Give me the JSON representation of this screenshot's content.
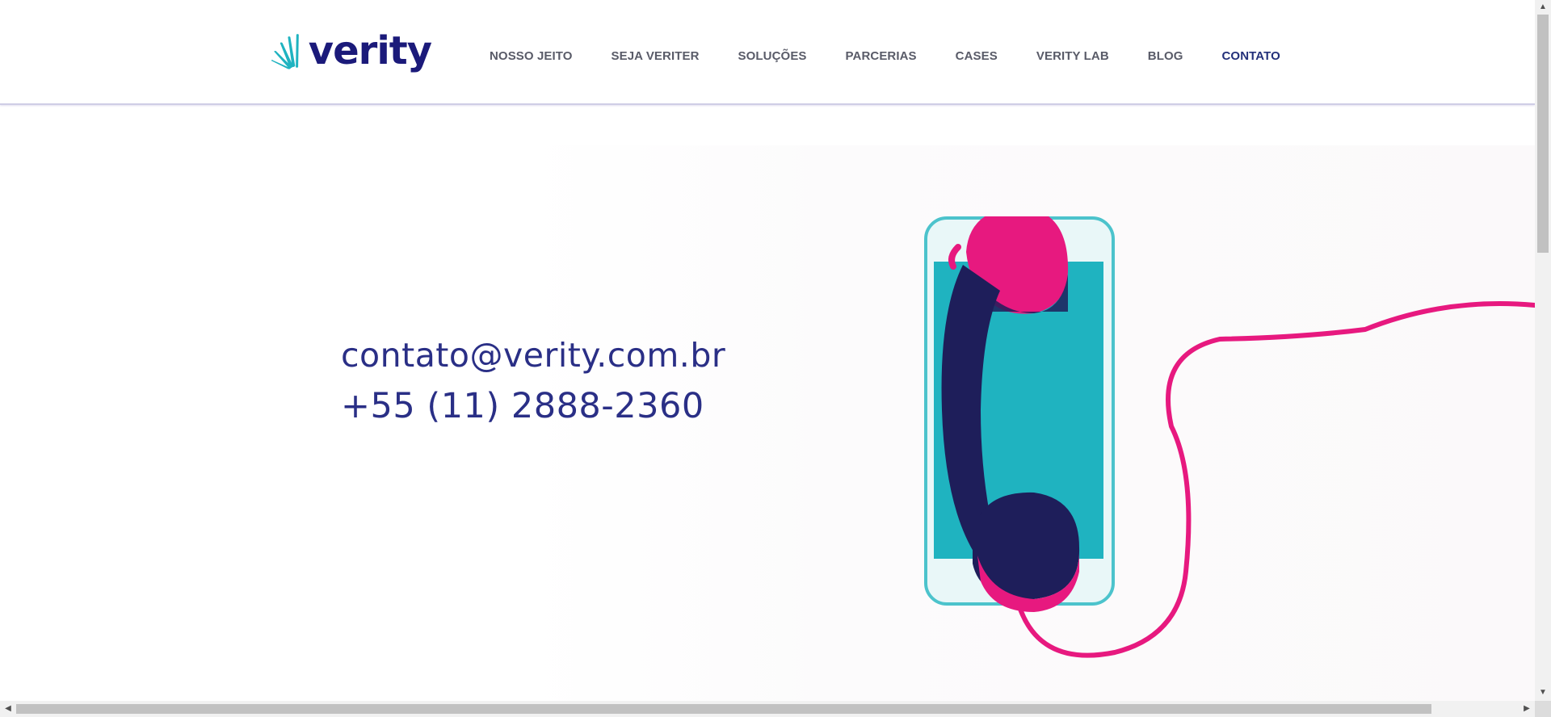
{
  "brand": {
    "name": "verity",
    "accent": "#1b1a7a",
    "dot_color": "#e7197f",
    "mark_color": "#1fb3c0"
  },
  "nav": {
    "items": [
      {
        "label": "NOSSO JEITO"
      },
      {
        "label": "SEJA VERITER"
      },
      {
        "label": "SOLUÇÕES"
      },
      {
        "label": "PARCERIAS"
      },
      {
        "label": "CASES"
      },
      {
        "label": "VERITY LAB"
      },
      {
        "label": "BLOG"
      },
      {
        "label": "CONTATO",
        "active": true
      }
    ]
  },
  "contact": {
    "email": "contato@verity.com.br",
    "phone": "+55 (11) 2888-2360"
  },
  "illustration": {
    "icon": "phone-handset-on-smartphone",
    "colors": [
      "#1fb3c0",
      "#e7197f",
      "#1e1e5a"
    ]
  }
}
